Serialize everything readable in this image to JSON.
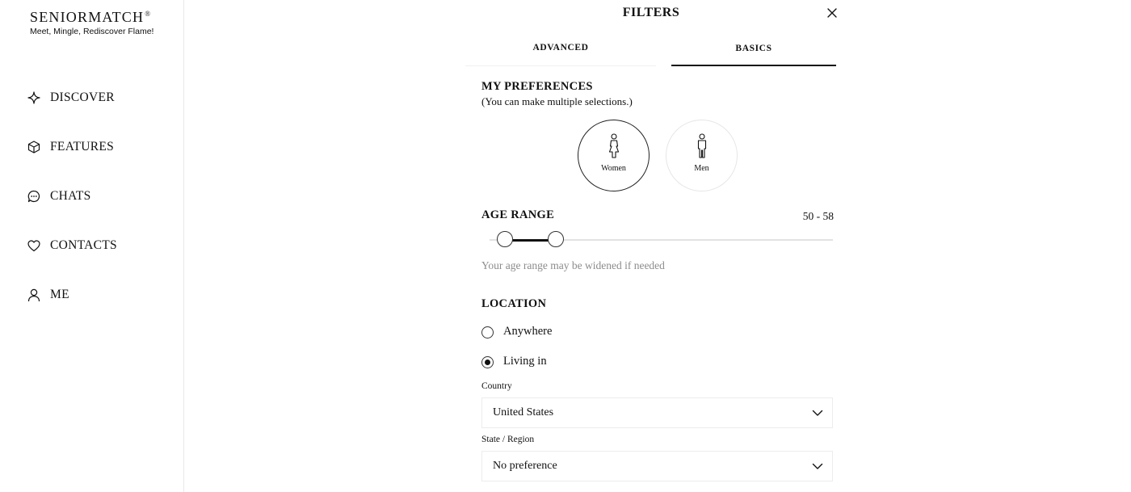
{
  "brand": {
    "name": "SENIORMATCH",
    "mark": "®",
    "tagline": "Meet, Mingle, Rediscover Flame!"
  },
  "nav": [
    {
      "label": "DISCOVER",
      "icon": "sparkle-icon"
    },
    {
      "label": "FEATURES",
      "icon": "cube-icon"
    },
    {
      "label": "CHATS",
      "icon": "chat-bubble-icon"
    },
    {
      "label": "CONTACTS",
      "icon": "heart-icon"
    },
    {
      "label": "ME",
      "icon": "user-icon"
    }
  ],
  "filters": {
    "title": "FILTERS",
    "tabs": [
      {
        "label": "ADVANCED",
        "active": false
      },
      {
        "label": "BASICS",
        "active": true
      }
    ],
    "preferences": {
      "title": "MY PREFERENCES",
      "subtitle": "(You can make multiple selections.)",
      "options": [
        {
          "label": "Women",
          "selected": true,
          "icon": "woman-icon"
        },
        {
          "label": "Men",
          "selected": false,
          "icon": "man-icon"
        }
      ]
    },
    "age_range": {
      "title": "AGE RANGE",
      "value": "50 - 58",
      "min_selected": 50,
      "max_selected": 58,
      "note": "Your age range may be widened if needed"
    },
    "location": {
      "title": "LOCATION",
      "options": [
        {
          "label": "Anywhere",
          "checked": false
        },
        {
          "label": "Living in",
          "checked": true
        }
      ],
      "country": {
        "label": "Country",
        "value": "United States"
      },
      "state": {
        "label": "State / Region",
        "value": "No preference"
      }
    }
  },
  "colors": {
    "text": "#111111",
    "muted": "#8c8c8c",
    "border": "#ececec",
    "background": "#ffffff"
  }
}
